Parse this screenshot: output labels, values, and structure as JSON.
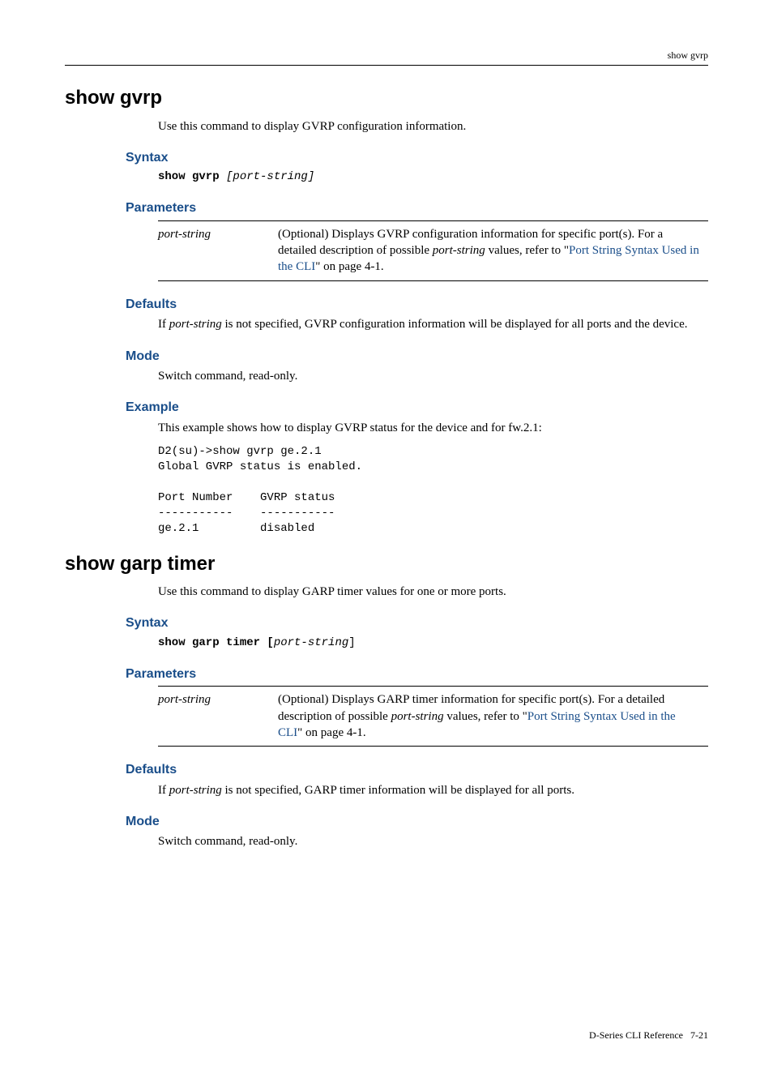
{
  "header": {
    "running_head": "show gvrp"
  },
  "section1": {
    "title": "show gvrp",
    "intro": "Use this command to display GVRP configuration information.",
    "syntax_heading": "Syntax",
    "syntax_cmd": "show gvrp ",
    "syntax_arg": "[port-string]",
    "parameters_heading": "Parameters",
    "param_name": "port-string",
    "param_desc_pre": "(Optional) Displays GVRP configuration information for specific port(s). For a detailed description of possible ",
    "param_desc_ital": "port-string",
    "param_desc_mid": " values, refer to \"",
    "param_link": "Port String Syntax Used in the CLI",
    "param_desc_post": "\" on page 4-1.",
    "defaults_heading": "Defaults",
    "defaults_pre": "If ",
    "defaults_ital": "port-string",
    "defaults_post": " is not specified, GVRP configuration information will be displayed for all ports and the device.",
    "mode_heading": "Mode",
    "mode_text": "Switch command, read-only.",
    "example_heading": "Example",
    "example_intro": "This example shows how to display GVRP status for the device and for fw.2.1:",
    "example_code": "D2(su)->show gvrp ge.2.1\nGlobal GVRP status is enabled.\n\nPort Number    GVRP status\n-----------    -----------\nge.2.1         disabled"
  },
  "section2": {
    "title": "show garp timer",
    "intro": "Use this command to display GARP timer values for one or more ports.",
    "syntax_heading": "Syntax",
    "syntax_cmd": "show garp timer [",
    "syntax_arg": "port-string",
    "syntax_close": "]",
    "parameters_heading": "Parameters",
    "param_name": "port-string",
    "param_desc_pre": "(Optional) Displays GARP timer information for specific port(s). For a detailed description of possible ",
    "param_desc_ital": "port-string",
    "param_desc_mid": " values, refer to \"",
    "param_link": "Port String Syntax Used in the CLI",
    "param_desc_post": "\" on page 4-1.",
    "defaults_heading": "Defaults",
    "defaults_pre": "If ",
    "defaults_ital": "port-string",
    "defaults_post": " is not specified, GARP timer information will be displayed for all ports.",
    "mode_heading": "Mode",
    "mode_text": "Switch command, read-only."
  },
  "footer": {
    "doc": "D-Series CLI Reference",
    "page": "7-21"
  }
}
